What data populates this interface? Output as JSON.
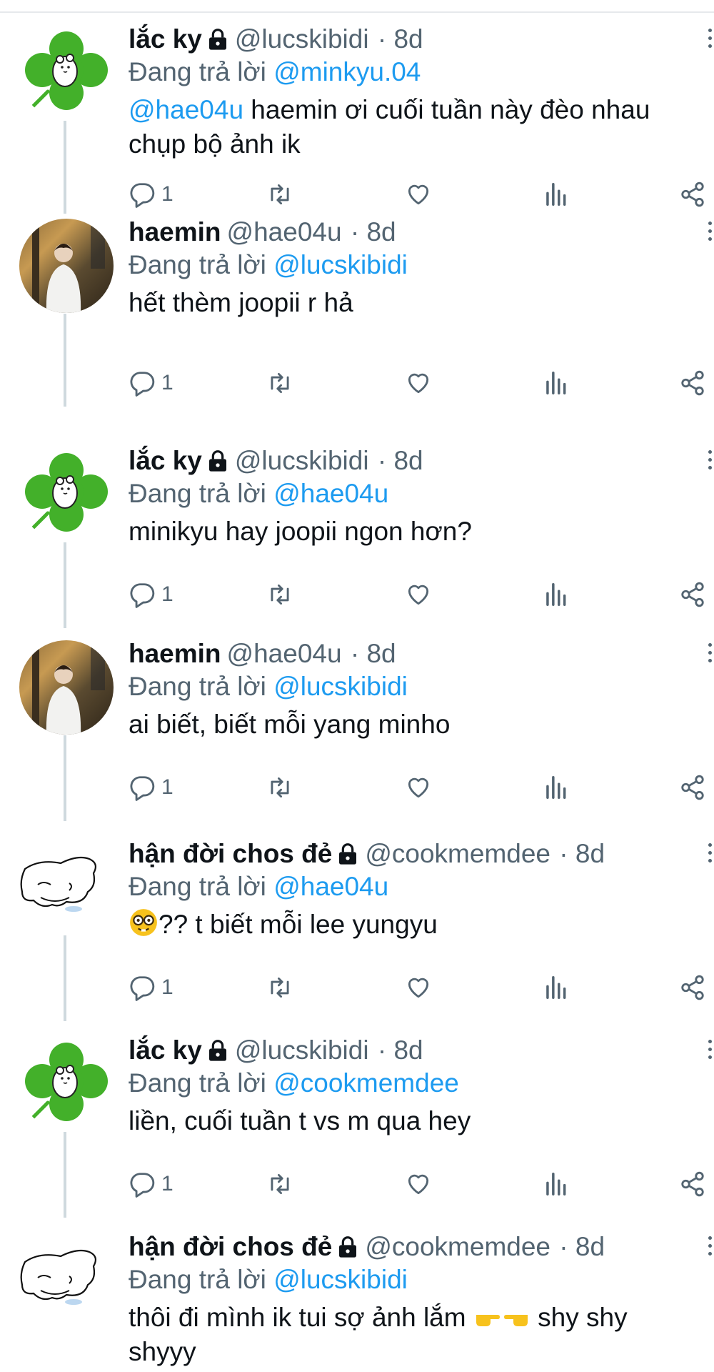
{
  "tweets": [
    {
      "name": "lắc ky",
      "locked": true,
      "handle": "@lucskibidi",
      "time": "· 8d",
      "replying_prefix": "Đang trả lời ",
      "replying_to": "@minkyu.04",
      "mention": "@hae04u",
      "text": " haemin ơi cuối tuần này đèo nhau chụp bộ ảnh ik",
      "reply_count": "1",
      "avatar": "clover-avatar"
    },
    {
      "name": "haemin",
      "locked": false,
      "handle": "@hae04u",
      "time": "· 8d",
      "replying_prefix": "Đang trả lời ",
      "replying_to": "@lucskibidi",
      "text": "hết thèm joopii r hả",
      "reply_count": "1",
      "avatar": "photo-avatar"
    },
    {
      "name": "lắc ky",
      "locked": true,
      "handle": "@lucskibidi",
      "time": "· 8d",
      "replying_prefix": "Đang trả lời ",
      "replying_to": "@hae04u",
      "text": "minikyu hay joopii ngon hơn?",
      "reply_count": "1",
      "avatar": "clover-avatar"
    },
    {
      "name": "haemin",
      "locked": false,
      "handle": "@hae04u",
      "time": "· 8d",
      "replying_prefix": "Đang trả lời ",
      "replying_to": "@lucskibidi",
      "text": "ai biết, biết mỗi yang minho",
      "reply_count": "1",
      "avatar": "photo-avatar"
    },
    {
      "name": "hận đời chos đẻ",
      "locked": true,
      "handle": "@cookmemdee",
      "time": "· 8d",
      "replying_prefix": "Đang trả lời ",
      "replying_to": "@hae04u",
      "text": "?? t biết mỗi lee yungyu",
      "reply_count": "1",
      "avatar": "sketch-avatar"
    },
    {
      "name": "lắc ky",
      "locked": true,
      "handle": "@lucskibidi",
      "time": "· 8d",
      "replying_prefix": "Đang trả lời ",
      "replying_to": "@cookmemdee",
      "text": "liền, cuối tuần t vs m qua hey",
      "reply_count": "1",
      "avatar": "clover-avatar"
    },
    {
      "name": "hận đời chos đẻ",
      "locked": true,
      "handle": "@cookmemdee",
      "time": "· 8d",
      "replying_prefix": "Đang trả lời ",
      "replying_to": "@lucskibidi",
      "text_a": "thôi đi mình ik tui sợ ảnh lắm ",
      "text_b": " shy shy shyyy",
      "avatar": "sketch-avatar"
    }
  ],
  "colors": {
    "link": "#1d9bf0",
    "muted": "#536471",
    "text": "#0f1419",
    "thread_line": "#cfd9de"
  }
}
